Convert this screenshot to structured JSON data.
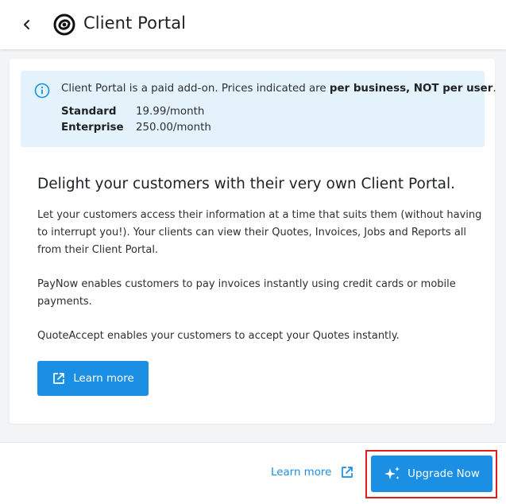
{
  "header": {
    "title": "Client Portal",
    "back_icon": "chevron-left-icon",
    "logo_icon": "swirl-logo-icon"
  },
  "info_box": {
    "icon": "info-icon",
    "text_prefix": "Client Portal is a paid add-on. Prices indicated are ",
    "text_bold": "per business, NOT per user",
    "text_suffix": ".",
    "plans": [
      {
        "name": "Standard",
        "price": "19.99/month"
      },
      {
        "name": "Enterprise",
        "price": "250.00/month"
      }
    ]
  },
  "content": {
    "headline": "Delight your customers with their very own Client Portal.",
    "paragraphs": [
      "Let your customers access their information at a time that suits them (without having to interrupt you!). Your clients can view their Quotes, Invoices, Jobs and Reports all from their Client Portal.",
      "PayNow enables customers to pay invoices instantly using credit cards or mobile payments.",
      "QuoteAccept enables your customers to accept your Quotes instantly."
    ],
    "learn_more_label": "Learn more",
    "learn_more_icon": "external-link-icon"
  },
  "footer": {
    "learn_more_label": "Learn more",
    "learn_more_icon": "external-link-icon",
    "upgrade_label": "Upgrade Now",
    "upgrade_icon": "sparkles-icon"
  },
  "colors": {
    "accent": "#1a8fe3",
    "info_bg": "#e4f3fb",
    "highlight_outline": "#e01e1e"
  }
}
